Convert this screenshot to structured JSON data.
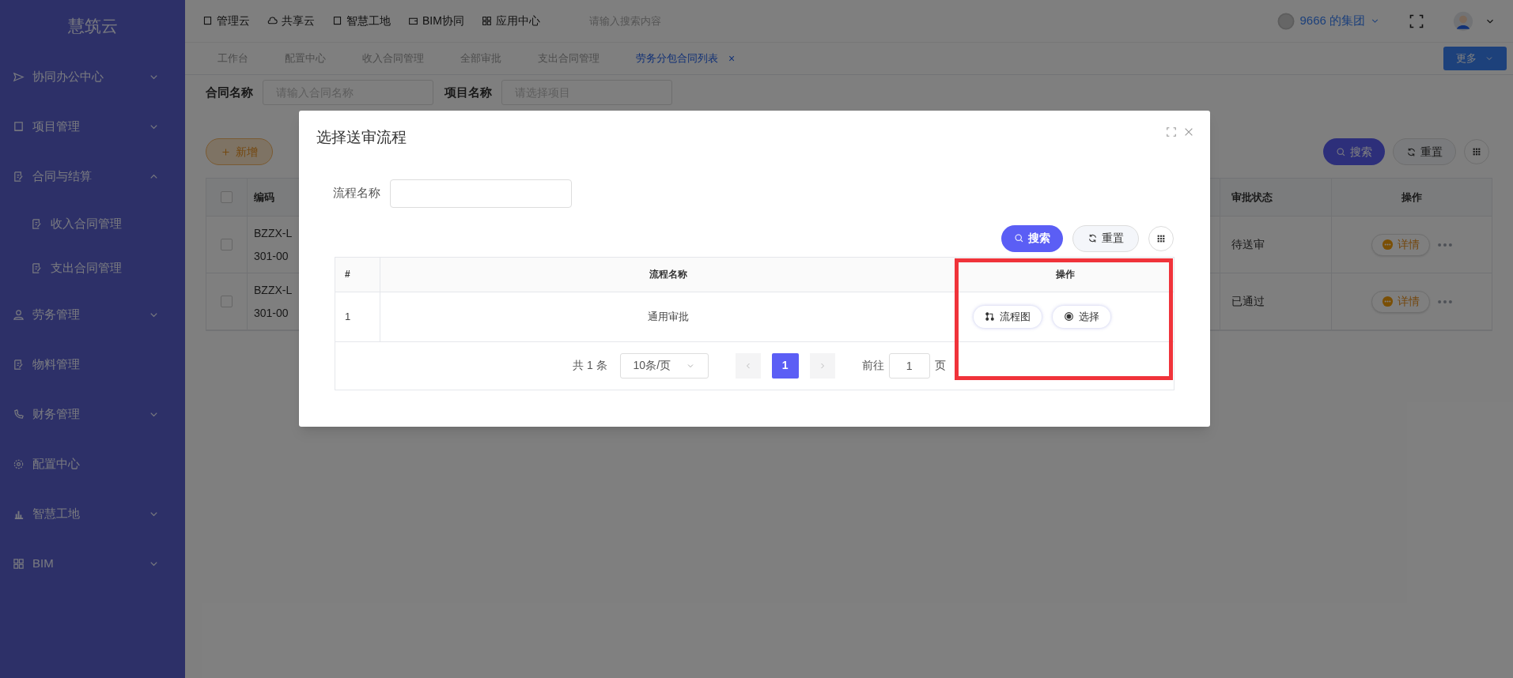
{
  "sidebar": {
    "logo": "慧筑云",
    "items": [
      {
        "label": "协同办公中心",
        "kind": "group",
        "expanded": false
      },
      {
        "label": "项目管理",
        "kind": "group",
        "expanded": false
      },
      {
        "label": "合同与结算",
        "kind": "group",
        "expanded": true,
        "children": [
          {
            "label": "收入合同管理"
          },
          {
            "label": "支出合同管理"
          }
        ]
      },
      {
        "label": "劳务管理",
        "kind": "group",
        "expanded": false
      },
      {
        "label": "物料管理",
        "kind": "link"
      },
      {
        "label": "财务管理",
        "kind": "group",
        "expanded": false
      },
      {
        "label": "配置中心",
        "kind": "link"
      },
      {
        "label": "智慧工地",
        "kind": "group",
        "expanded": false
      },
      {
        "label": "BIM",
        "kind": "group",
        "expanded": false
      }
    ]
  },
  "top_bar": {
    "nav": [
      "管理云",
      "共享云",
      "智慧工地",
      "BIM协同",
      "应用中心"
    ],
    "search": {
      "placeholder": "请输入搜索内容"
    },
    "org": "9666 的集团"
  },
  "tabs": [
    {
      "label": "工作台",
      "selected": false,
      "closable": false
    },
    {
      "label": "配置中心",
      "selected": false,
      "closable": false
    },
    {
      "label": "收入合同管理",
      "selected": false,
      "closable": false
    },
    {
      "label": "全部审批",
      "selected": false,
      "closable": false
    },
    {
      "label": "支出合同管理",
      "selected": false,
      "closable": false
    },
    {
      "label": "劳务分包合同列表",
      "selected": true,
      "closable": true,
      "close": "×"
    }
  ],
  "more_button": "更多",
  "filters": [
    {
      "label": "合同名称",
      "placeholder": "请输入合同名称"
    },
    {
      "label": "项目名称",
      "placeholder": "请选择项目"
    }
  ],
  "add_button": "新增",
  "search_button": "搜索",
  "reset_button": "重置",
  "table": {
    "all_checked": false,
    "columns": [
      "编码",
      "审批状态",
      "操作"
    ],
    "rows": [
      {
        "checked": false,
        "code": [
          "BZZX-L",
          "301-00"
        ],
        "status": "待送审",
        "action": "详情"
      },
      {
        "checked": false,
        "code": [
          "BZZX-L",
          "301-00"
        ],
        "status": "已通过",
        "action": "详情"
      }
    ]
  },
  "dialog": {
    "title": "选择送审流程",
    "field": {
      "label": "流程名称"
    },
    "search_button": "搜索",
    "reset_button": "重置",
    "table": {
      "columns": [
        "#",
        "流程名称",
        "操作"
      ],
      "rows": [
        {
          "index": "1",
          "name": "通用审批",
          "actions": [
            "流程图",
            "选择"
          ]
        }
      ]
    },
    "pagination": {
      "total": "共 1 条",
      "page_size": "10条/页",
      "pages": [
        {
          "label": "1",
          "selected": true
        }
      ],
      "goto_label": "前往",
      "goto_value": "1",
      "goto_suffix": "页"
    },
    "highlight": true
  }
}
